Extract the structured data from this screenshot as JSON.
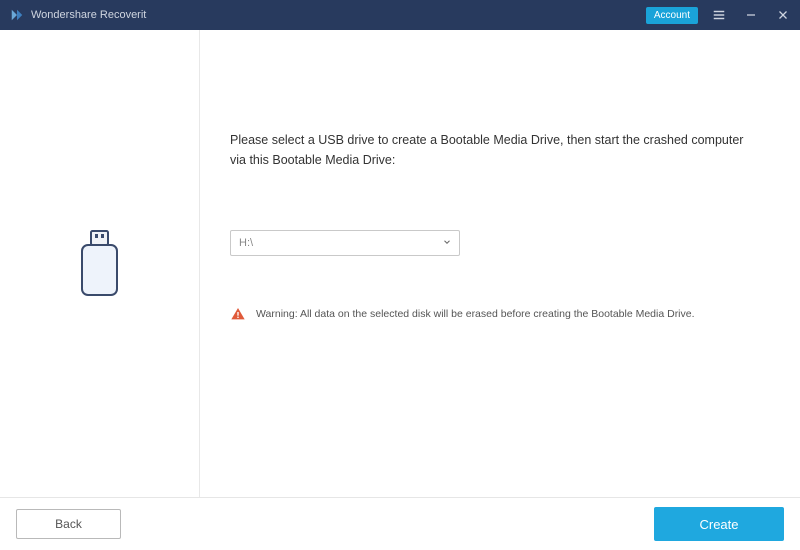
{
  "titlebar": {
    "app_name": "Wondershare Recoverit",
    "account_label": "Account"
  },
  "content": {
    "instruction": "Please select a USB drive to create a Bootable Media Drive, then start the crashed computer via this Bootable Media Drive:",
    "selected_drive": "H:\\",
    "warning_text": "Warning: All data on the selected disk will be erased before creating the Bootable Media Drive."
  },
  "footer": {
    "back_label": "Back",
    "create_label": "Create"
  },
  "colors": {
    "header": "#283a5e",
    "primary": "#1fa8df",
    "warn": "#e05a3a"
  }
}
